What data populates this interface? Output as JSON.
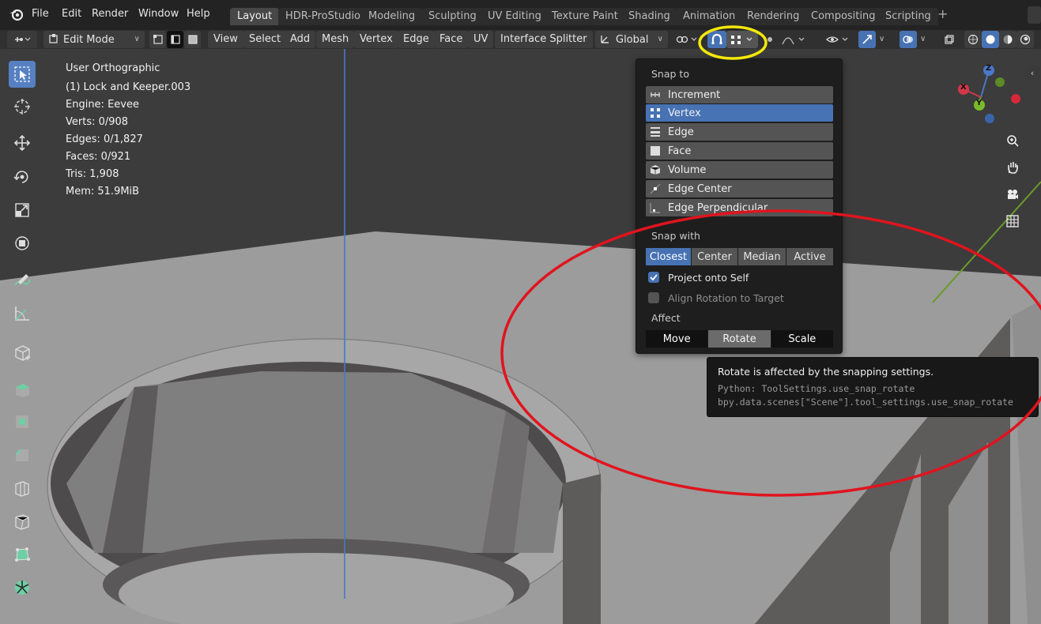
{
  "menu": {
    "items": [
      "File",
      "Edit",
      "Render",
      "Window",
      "Help"
    ]
  },
  "workspace_tabs": [
    {
      "label": "Layout",
      "active": true
    },
    {
      "label": "HDR-ProStudio",
      "active": false
    },
    {
      "label": "Modeling",
      "active": false
    },
    {
      "label": "Sculpting",
      "active": false
    },
    {
      "label": "UV Editing",
      "active": false
    },
    {
      "label": "Texture Paint",
      "active": false
    },
    {
      "label": "Shading",
      "active": false
    },
    {
      "label": "Animation",
      "active": false
    },
    {
      "label": "Rendering",
      "active": false
    },
    {
      "label": "Compositing",
      "active": false
    },
    {
      "label": "Scripting",
      "active": false
    }
  ],
  "add_workspace": "+",
  "header": {
    "mode": "Edit Mode",
    "menus": [
      "View",
      "Select",
      "Add",
      "Mesh",
      "Vertex",
      "Edge",
      "Face",
      "UV",
      "Interface Splitter"
    ],
    "orientation": "Global"
  },
  "viewport_info": {
    "view": "User Orthographic",
    "object": "(1) Lock and Keeper.003",
    "engine": "Engine: Eevee",
    "verts": "Verts: 0/908",
    "edges": "Edges: 0/1,827",
    "faces": "Faces: 0/921",
    "tris": "Tris: 1,908",
    "mem": "Mem: 51.9MiB"
  },
  "gizmo": {
    "z": "Z",
    "x": "X",
    "y": "Y"
  },
  "snap_popover": {
    "snap_to_label": "Snap to",
    "snap_to_items": [
      {
        "label": "Increment",
        "icon": "increment-icon",
        "selected": false
      },
      {
        "label": "Vertex",
        "icon": "vertex-icon",
        "selected": true
      },
      {
        "label": "Edge",
        "icon": "edge-icon",
        "selected": false
      },
      {
        "label": "Face",
        "icon": "face-icon",
        "selected": false
      },
      {
        "label": "Volume",
        "icon": "volume-icon",
        "selected": false
      },
      {
        "label": "Edge Center",
        "icon": "edge-center-icon",
        "selected": false
      },
      {
        "label": "Edge Perpendicular",
        "icon": "edge-perpendicular-icon",
        "selected": false
      }
    ],
    "snap_with_label": "Snap with",
    "snap_with_items": [
      {
        "label": "Closest",
        "selected": true
      },
      {
        "label": "Center",
        "selected": false
      },
      {
        "label": "Median",
        "selected": false
      },
      {
        "label": "Active",
        "selected": false
      }
    ],
    "project_onto_self": {
      "label": "Project onto Self",
      "checked": true
    },
    "align_rotation": {
      "label": "Align Rotation to Target",
      "checked": false
    },
    "affect_label": "Affect",
    "affect_items": [
      {
        "label": "Move",
        "state": "on"
      },
      {
        "label": "Rotate",
        "state": "hover"
      },
      {
        "label": "Scale",
        "state": "on"
      }
    ]
  },
  "tooltip": {
    "title": "Rotate is affected by the snapping settings.",
    "python_line1": "Python: ToolSettings.use_snap_rotate",
    "python_line2": "bpy.data.scenes[\"Scene\"].tool_settings.use_snap_rotate"
  },
  "colors": {
    "accent_blue": "#4772b3",
    "annotation_red": "#e0141e",
    "annotation_yellow": "#f4e80a"
  }
}
